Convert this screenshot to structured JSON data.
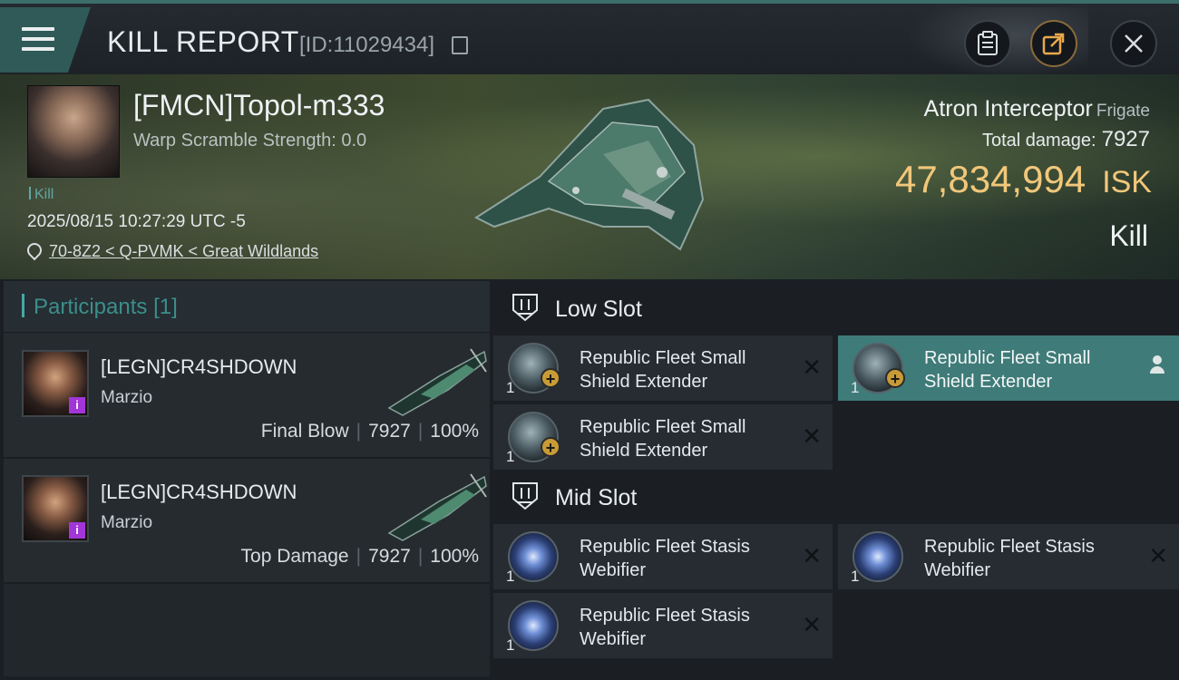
{
  "header": {
    "title": "KILL REPORT",
    "report_id": "[ID:11029434]"
  },
  "victim": {
    "pilot_name": "[FMCN]Topol-m333",
    "warp_scramble": "Warp Scramble Strength: 0.0",
    "kill_tag": "Kill",
    "timestamp": "2025/08/15 10:27:29 UTC -5",
    "location": "70-8Z2 < Q-PVMK < Great Wildlands",
    "ship_name": "Atron Interceptor",
    "ship_class": "Frigate",
    "total_damage_label": "Total damage:",
    "total_damage": "7927",
    "isk_value": "47,834,994",
    "isk_unit": "ISK",
    "result": "Kill"
  },
  "participants": {
    "title": "Participants",
    "count": "[1]",
    "rows": [
      {
        "name": "[LEGN]CR4SHDOWN",
        "ship": "Marzio",
        "role": "Final Blow",
        "damage": "7927",
        "percent": "100%",
        "badge": "i"
      },
      {
        "name": "[LEGN]CR4SHDOWN",
        "ship": "Marzio",
        "role": "Top Damage",
        "damage": "7927",
        "percent": "100%",
        "badge": "i"
      }
    ]
  },
  "slots": {
    "low": {
      "label": "Low Slot",
      "modules": [
        {
          "qty": "1",
          "name_line1": "Republic Fleet Small",
          "name_line2": "Shield Extender"
        },
        {
          "qty": "1",
          "name_line1": "Republic Fleet Small",
          "name_line2": "Shield Extender"
        },
        {
          "qty": "1",
          "name_line1": "Republic Fleet Small",
          "name_line2": "Shield Extender"
        }
      ]
    },
    "mid": {
      "label": "Mid Slot",
      "modules": [
        {
          "qty": "1",
          "name_line1": "Republic Fleet Stasis",
          "name_line2": "Webifier"
        },
        {
          "qty": "1",
          "name_line1": "Republic Fleet Stasis",
          "name_line2": "Webifier"
        },
        {
          "qty": "1",
          "name_line1": "Republic Fleet Stasis",
          "name_line2": "Webifier"
        }
      ]
    }
  },
  "colors": {
    "accent": "#3f7b78",
    "isk": "#f2c77a",
    "badge": "#a235d8"
  }
}
